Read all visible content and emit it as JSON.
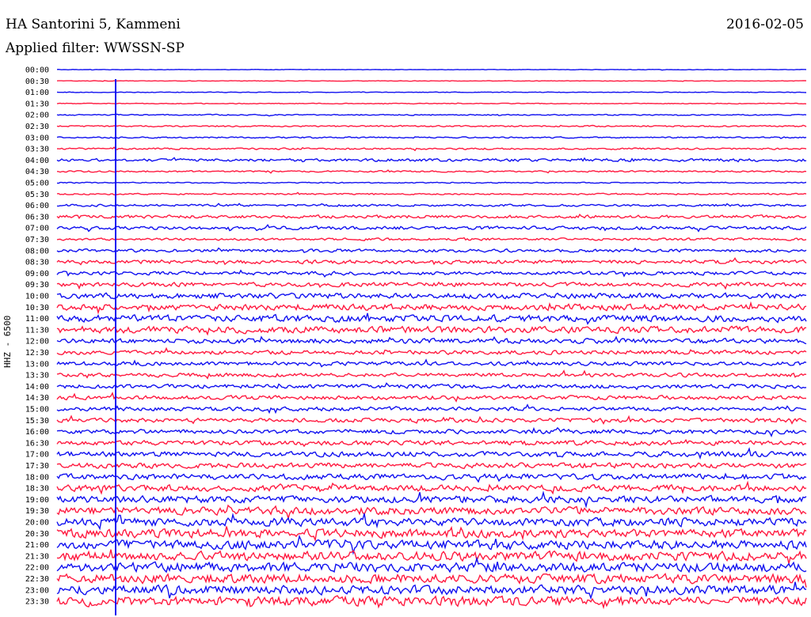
{
  "header": {
    "station": "HA Santorini 5, Kammeni",
    "date": "2016-02-05",
    "filter": "Applied filter: WWSSN-SP"
  },
  "chart_data": {
    "type": "line",
    "title": "HA Santorini 5, Kammeni",
    "ylabel": "HHZ - 6500",
    "row_labels": [
      "00:00",
      "00:30",
      "01:00",
      "01:30",
      "02:00",
      "02:30",
      "03:00",
      "03:30",
      "04:00",
      "04:30",
      "05:00",
      "05:30",
      "06:00",
      "06:30",
      "07:00",
      "07:30",
      "08:00",
      "08:30",
      "09:00",
      "09:30",
      "10:00",
      "10:30",
      "11:00",
      "11:30",
      "12:00",
      "12:30",
      "13:00",
      "13:30",
      "14:00",
      "14:30",
      "15:00",
      "15:30",
      "16:00",
      "16:30",
      "17:00",
      "17:30",
      "18:00",
      "18:30",
      "19:00",
      "19:30",
      "20:00",
      "20:30",
      "21:00",
      "21:30",
      "22:00",
      "22:30",
      "23:00",
      "23:30"
    ],
    "amplitude": [
      0.4,
      0.4,
      0.5,
      0.6,
      0.9,
      1.1,
      1.0,
      1.3,
      2.2,
      1.2,
      0.8,
      1.1,
      1.7,
      2.4,
      2.6,
      1.8,
      2.4,
      2.9,
      2.8,
      3.2,
      4.2,
      4.8,
      5.3,
      5.1,
      3.8,
      3.1,
      3.0,
      2.9,
      3.0,
      3.1,
      3.1,
      3.2,
      3.4,
      3.6,
      3.9,
      4.1,
      4.4,
      4.9,
      5.4,
      5.9,
      6.3,
      6.7,
      6.9,
      7.1,
      7.3,
      7.2,
      7.0,
      7.4
    ],
    "series_colors": [
      "#1010f0",
      "#ff1a40"
    ],
    "line_grid": "off"
  }
}
